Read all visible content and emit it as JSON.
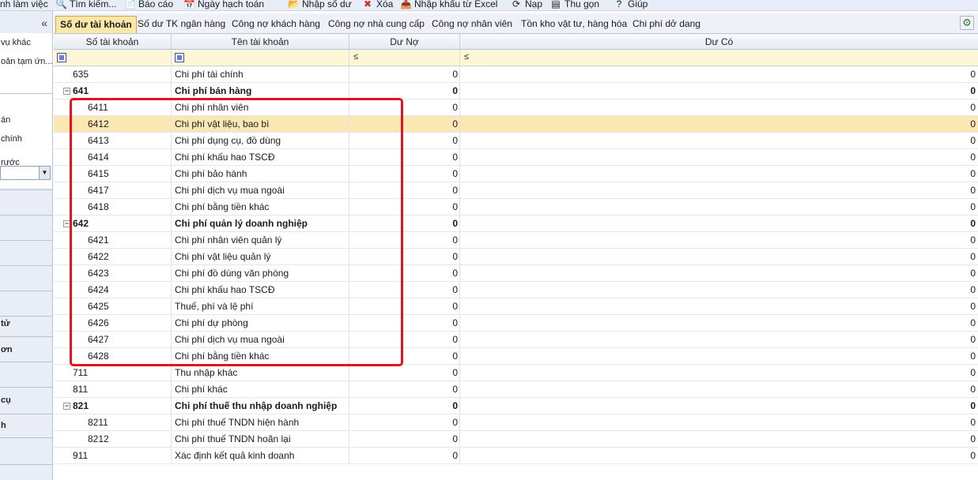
{
  "toolbar": {
    "items": [
      {
        "label": "nh làm việc",
        "icon": "none"
      },
      {
        "label": "Tìm kiếm...",
        "icon": "search-icon"
      },
      {
        "label": "Báo cáo",
        "icon": "report-icon"
      },
      {
        "label": "Ngày hạch toán",
        "icon": "calendar-icon"
      },
      {
        "label": "Nhập số dư",
        "icon": "folder-icon"
      },
      {
        "label": "Xóa",
        "icon": "delete-icon"
      },
      {
        "label": "Nhập khẩu từ Excel",
        "icon": "excel-import-icon"
      },
      {
        "label": "Nạp",
        "icon": "reload-icon"
      },
      {
        "label": "Thu gọn",
        "icon": "collapse-icon"
      },
      {
        "label": "Giúp",
        "icon": "help-icon"
      }
    ]
  },
  "left_panel": {
    "collapse_icon": "«",
    "items": [
      {
        "label": "vụ khác",
        "bold": false
      },
      {
        "label": "oản tạm ứn...",
        "bold": false
      },
      {
        "label": "án",
        "bold": false
      },
      {
        "label": "chính",
        "bold": false
      },
      {
        "label": "rước",
        "bold": false
      },
      {
        "label": "tử",
        "bold": true
      },
      {
        "label": "ơn",
        "bold": true
      },
      {
        "label": "cụ",
        "bold": true
      },
      {
        "label": "h",
        "bold": true
      }
    ]
  },
  "tabs": [
    {
      "label": "Số dư tài khoản",
      "active": true
    },
    {
      "label": "Số dư TK ngân hàng",
      "active": false
    },
    {
      "label": "Công nợ khách hàng",
      "active": false
    },
    {
      "label": "Công nợ nhà cung cấp",
      "active": false
    },
    {
      "label": "Công nợ nhân viên",
      "active": false
    },
    {
      "label": "Tồn kho vật tư, hàng hóa",
      "active": false
    },
    {
      "label": "Chi phí dở dang",
      "active": false
    }
  ],
  "grid": {
    "columns": [
      "Số tài khoản",
      "Tên tài khoản",
      "Dư Nợ",
      "Dư Có"
    ],
    "filter_ops": [
      "",
      "",
      "≤",
      "≤"
    ],
    "rows": [
      {
        "acct": "635",
        "name": "Chi phí tài chính",
        "debit": "0",
        "credit": "0",
        "level": 0,
        "group": false
      },
      {
        "acct": "641",
        "name": "Chi phí bán hàng",
        "debit": "0",
        "credit": "0",
        "level": 0,
        "group": true
      },
      {
        "acct": "6411",
        "name": "Chi phí nhân viên",
        "debit": "0",
        "credit": "0",
        "level": 1,
        "group": false
      },
      {
        "acct": "6412",
        "name": "Chi phí vật liệu, bao bì",
        "debit": "0",
        "credit": "0",
        "level": 1,
        "group": false,
        "selected": true
      },
      {
        "acct": "6413",
        "name": "Chi phí dụng cụ, đồ dùng",
        "debit": "0",
        "credit": "0",
        "level": 1,
        "group": false
      },
      {
        "acct": "6414",
        "name": "Chi phí khấu hao TSCĐ",
        "debit": "0",
        "credit": "0",
        "level": 1,
        "group": false
      },
      {
        "acct": "6415",
        "name": "Chi phí bảo hành",
        "debit": "0",
        "credit": "0",
        "level": 1,
        "group": false
      },
      {
        "acct": "6417",
        "name": "Chi phí dịch vụ mua ngoài",
        "debit": "0",
        "credit": "0",
        "level": 1,
        "group": false
      },
      {
        "acct": "6418",
        "name": "Chi phí bằng tiền khác",
        "debit": "0",
        "credit": "0",
        "level": 1,
        "group": false
      },
      {
        "acct": "642",
        "name": "Chi phí quản lý doanh nghiệp",
        "debit": "0",
        "credit": "0",
        "level": 0,
        "group": true
      },
      {
        "acct": "6421",
        "name": "Chi phí nhân viên quản lý",
        "debit": "0",
        "credit": "0",
        "level": 1,
        "group": false
      },
      {
        "acct": "6422",
        "name": "Chi phí vật liệu quản lý",
        "debit": "0",
        "credit": "0",
        "level": 1,
        "group": false
      },
      {
        "acct": "6423",
        "name": "Chi phí đồ dùng văn phòng",
        "debit": "0",
        "credit": "0",
        "level": 1,
        "group": false
      },
      {
        "acct": "6424",
        "name": "Chi phí khấu hao TSCĐ",
        "debit": "0",
        "credit": "0",
        "level": 1,
        "group": false
      },
      {
        "acct": "6425",
        "name": "Thuế, phí và lệ phí",
        "debit": "0",
        "credit": "0",
        "level": 1,
        "group": false
      },
      {
        "acct": "6426",
        "name": "Chi phí dự phòng",
        "debit": "0",
        "credit": "0",
        "level": 1,
        "group": false
      },
      {
        "acct": "6427",
        "name": "Chi phí dịch vụ mua ngoài",
        "debit": "0",
        "credit": "0",
        "level": 1,
        "group": false
      },
      {
        "acct": "6428",
        "name": "Chi phí bằng tiền khác",
        "debit": "0",
        "credit": "0",
        "level": 1,
        "group": false
      },
      {
        "acct": "711",
        "name": "Thu nhập khác",
        "debit": "0",
        "credit": "0",
        "level": 0,
        "group": false
      },
      {
        "acct": "811",
        "name": "Chi phí khác",
        "debit": "0",
        "credit": "0",
        "level": 0,
        "group": false
      },
      {
        "acct": "821",
        "name": "Chi phí thuế thu nhập doanh nghiệp",
        "debit": "0",
        "credit": "0",
        "level": 0,
        "group": true
      },
      {
        "acct": "8211",
        "name": "Chi phí thuế TNDN hiện hành",
        "debit": "0",
        "credit": "0",
        "level": 1,
        "group": false
      },
      {
        "acct": "8212",
        "name": "Chi phí thuế TNDN hoãn lại",
        "debit": "0",
        "credit": "0",
        "level": 1,
        "group": false
      },
      {
        "acct": "911",
        "name": "Xác định kết quả kinh doanh",
        "debit": "0",
        "credit": "0",
        "level": 0,
        "group": false
      }
    ]
  },
  "colors": {
    "active_tab": "#fbe8a8",
    "selected_row": "#fbe7b2",
    "filter_row": "#fdf7d7",
    "highlight_border": "#e0141e"
  }
}
